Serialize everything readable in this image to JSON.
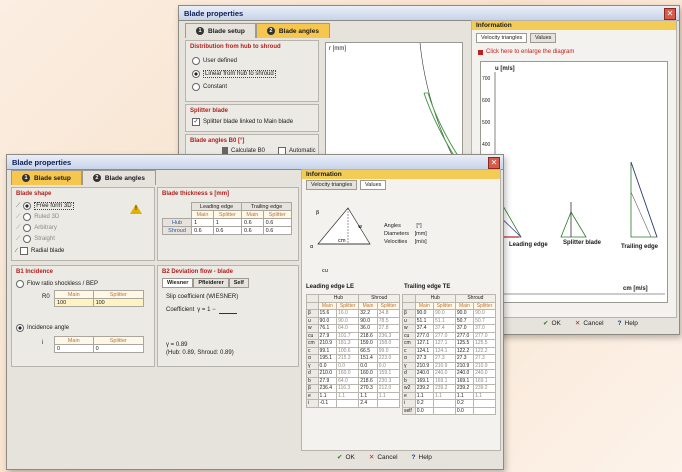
{
  "back_window": {
    "title": "Blade properties",
    "tabs": [
      {
        "num": "1",
        "label": "Blade setup"
      },
      {
        "num": "2",
        "label": "Blade angles"
      }
    ],
    "distribution": {
      "title": "Distribution from hub to shroud",
      "options": [
        "User defined",
        "Linear from hub to shroud",
        "Constant"
      ]
    },
    "splitter": {
      "title": "Splitter blade",
      "checkbox_label": "Splitter blade linked to Main blade"
    },
    "blade_angles": {
      "title": "Blade angles B0 [°]",
      "calc_label": "Calculate B0",
      "auto_label": "Automatic"
    },
    "plot_label": "r [mm]",
    "info": {
      "title": "Information",
      "tabs": [
        "Velocity triangles",
        "Values"
      ],
      "enlarge_text": "Click here to enlarge the diagram",
      "ylabel": "u [m/s]",
      "yticks": [
        "700",
        "600",
        "500",
        "400",
        "300"
      ],
      "xlabel": "cm [m/s]",
      "labels": {
        "leading": "Leading edge",
        "splitter": "Splitter blade",
        "trailing": "Trailing edge"
      }
    },
    "buttons": {
      "ok": "OK",
      "cancel": "Cancel",
      "help": "Help"
    }
  },
  "front_window": {
    "title": "Blade properties",
    "tabs": [
      {
        "num": "1",
        "label": "Blade setup"
      },
      {
        "num": "2",
        "label": "Blade angles"
      }
    ],
    "blade_shape": {
      "title": "Blade shape",
      "options": [
        "Free form 3D",
        "Ruled 3D",
        "Arbitrary",
        "Straight",
        "Radial blade"
      ]
    },
    "thickness": {
      "title": "Blade thickness s [mm]",
      "col_groups": [
        "Leading edge",
        "Trailing edge"
      ],
      "cols": [
        "Main",
        "Splitter",
        "Main",
        "Splitter"
      ],
      "rows": [
        {
          "label": "Hub",
          "values": [
            "1",
            "1",
            "0.6",
            "0.6"
          ]
        },
        {
          "label": "Shroud",
          "values": [
            "0.6",
            "0.6",
            "0.6",
            "0.6"
          ]
        }
      ]
    },
    "incidence": {
      "title": "B1 Incidence",
      "flow_ratio_label": "Flow ratio shockless / BEP",
      "row_label": "R0",
      "cols": [
        "Main",
        "Splitter"
      ],
      "flow_values": [
        "100",
        "100"
      ],
      "angle_label": "Incidence angle",
      "angle_row_label": "i",
      "angle_values": [
        "0",
        "0"
      ]
    },
    "deviation": {
      "title": "B2 Deviation flow - blade",
      "tabs": [
        "Wiesner",
        "Pfleiderer",
        "Self"
      ],
      "slip_label": "Slip coefficient (WIESNER)",
      "coef_label": "Coefficient",
      "formula": "γ = 1 −",
      "result1": "γ = 0.89",
      "result2": "(Hub: 0.89, Shroud: 0.89)"
    },
    "info": {
      "title": "Information",
      "tabs": [
        "Velocity triangles",
        "Values"
      ],
      "legend": {
        "angles_label": "Angles",
        "angles_unit": "[°]",
        "diameters_label": "Diameters",
        "diameters_unit": "[mm]",
        "velocities_label": "Velocities",
        "velocities_unit": "[m/s]"
      },
      "le_title": "Leading edge LE",
      "te_title": "Trailing edge TE",
      "groups": [
        "Hub",
        "Shroud"
      ],
      "cols": [
        "Main",
        "Splitter",
        "Main",
        "Splitter"
      ],
      "le_rows": [
        [
          "β",
          "15.6",
          "16.0",
          "32.2",
          "34.8"
        ],
        [
          "u",
          "90.0",
          "90.0",
          "90.0",
          "78.5"
        ],
        [
          "w",
          "76.1",
          "64.0",
          "36.0",
          "27.8"
        ],
        [
          "cu",
          "27.9",
          "101.7",
          "218.6",
          "236.3"
        ],
        [
          "cm",
          "210.9",
          "181.3",
          "159.0",
          "158.0"
        ],
        [
          "c",
          "99.1",
          "100.6",
          "66.5",
          "99.0"
        ],
        [
          "α",
          "195.1",
          "215.3",
          "151.4",
          "223.0"
        ],
        [
          "γ",
          "0.0",
          "0.0",
          "0.0",
          "0.0"
        ],
        [
          "d",
          "210.0",
          "160.0",
          "160.0",
          "159.1"
        ],
        [
          "b",
          "27.9",
          "64.0",
          "218.6",
          "230.3"
        ],
        [
          "β",
          "236.4",
          "116.3",
          "270.3",
          "212.0"
        ],
        [
          "e",
          "1.1",
          "1.1",
          "1.1",
          "1.1"
        ],
        [
          "i",
          "-0.1",
          "",
          "2.4",
          ""
        ]
      ],
      "te_rows": [
        [
          "β",
          "90.0",
          "90.0",
          "90.0",
          "90.0"
        ],
        [
          "u",
          "51.1",
          "51.1",
          "50.7",
          "50.7"
        ],
        [
          "w",
          "37.4",
          "37.4",
          "37.0",
          "37.0"
        ],
        [
          "cu",
          "277.0",
          "277.0",
          "277.0",
          "277.0"
        ],
        [
          "cm",
          "127.1",
          "127.1",
          "125.5",
          "125.5"
        ],
        [
          "c",
          "124.1",
          "124.1",
          "122.2",
          "122.2"
        ],
        [
          "α",
          "27.3",
          "27.3",
          "27.3",
          "27.3"
        ],
        [
          "γ",
          "210.9",
          "210.9",
          "210.9",
          "210.9"
        ],
        [
          "d",
          "240.0",
          "240.0",
          "240.0",
          "240.0"
        ],
        [
          "b",
          "169.1",
          "169.1",
          "169.1",
          "169.1"
        ],
        [
          "w2",
          "239.2",
          "239.2",
          "239.2",
          "239.2"
        ],
        [
          "e",
          "1.1",
          "1.1",
          "1.1",
          "1.1"
        ],
        [
          "i",
          "0.2",
          "",
          "0.2",
          ""
        ],
        [
          "self",
          "0.0",
          "",
          "0.0",
          ""
        ]
      ]
    },
    "buttons": {
      "ok": "OK",
      "cancel": "Cancel",
      "help": "Help"
    }
  }
}
